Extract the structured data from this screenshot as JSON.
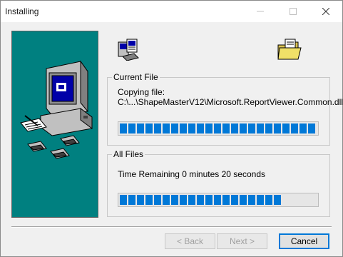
{
  "window": {
    "title": "Installing"
  },
  "current_file": {
    "group_label": "Current File",
    "action": "Copying file:",
    "path": "C:\\...\\ShapeMasterV12\\Microsoft.ReportViewer.Common.dll",
    "progress": 1.0
  },
  "all_files": {
    "group_label": "All Files",
    "time_remaining": "Time Remaining 0 minutes 20 seconds",
    "progress": 0.84
  },
  "buttons": {
    "back": "< Back",
    "next": "Next >",
    "cancel": "Cancel"
  },
  "colors": {
    "accent": "#0078d7",
    "sidebar": "#008080"
  },
  "icons": [
    "minimize-icon",
    "maximize-icon",
    "close-icon",
    "computer-setup-icon",
    "disk-transfer-icon",
    "folder-icon"
  ]
}
